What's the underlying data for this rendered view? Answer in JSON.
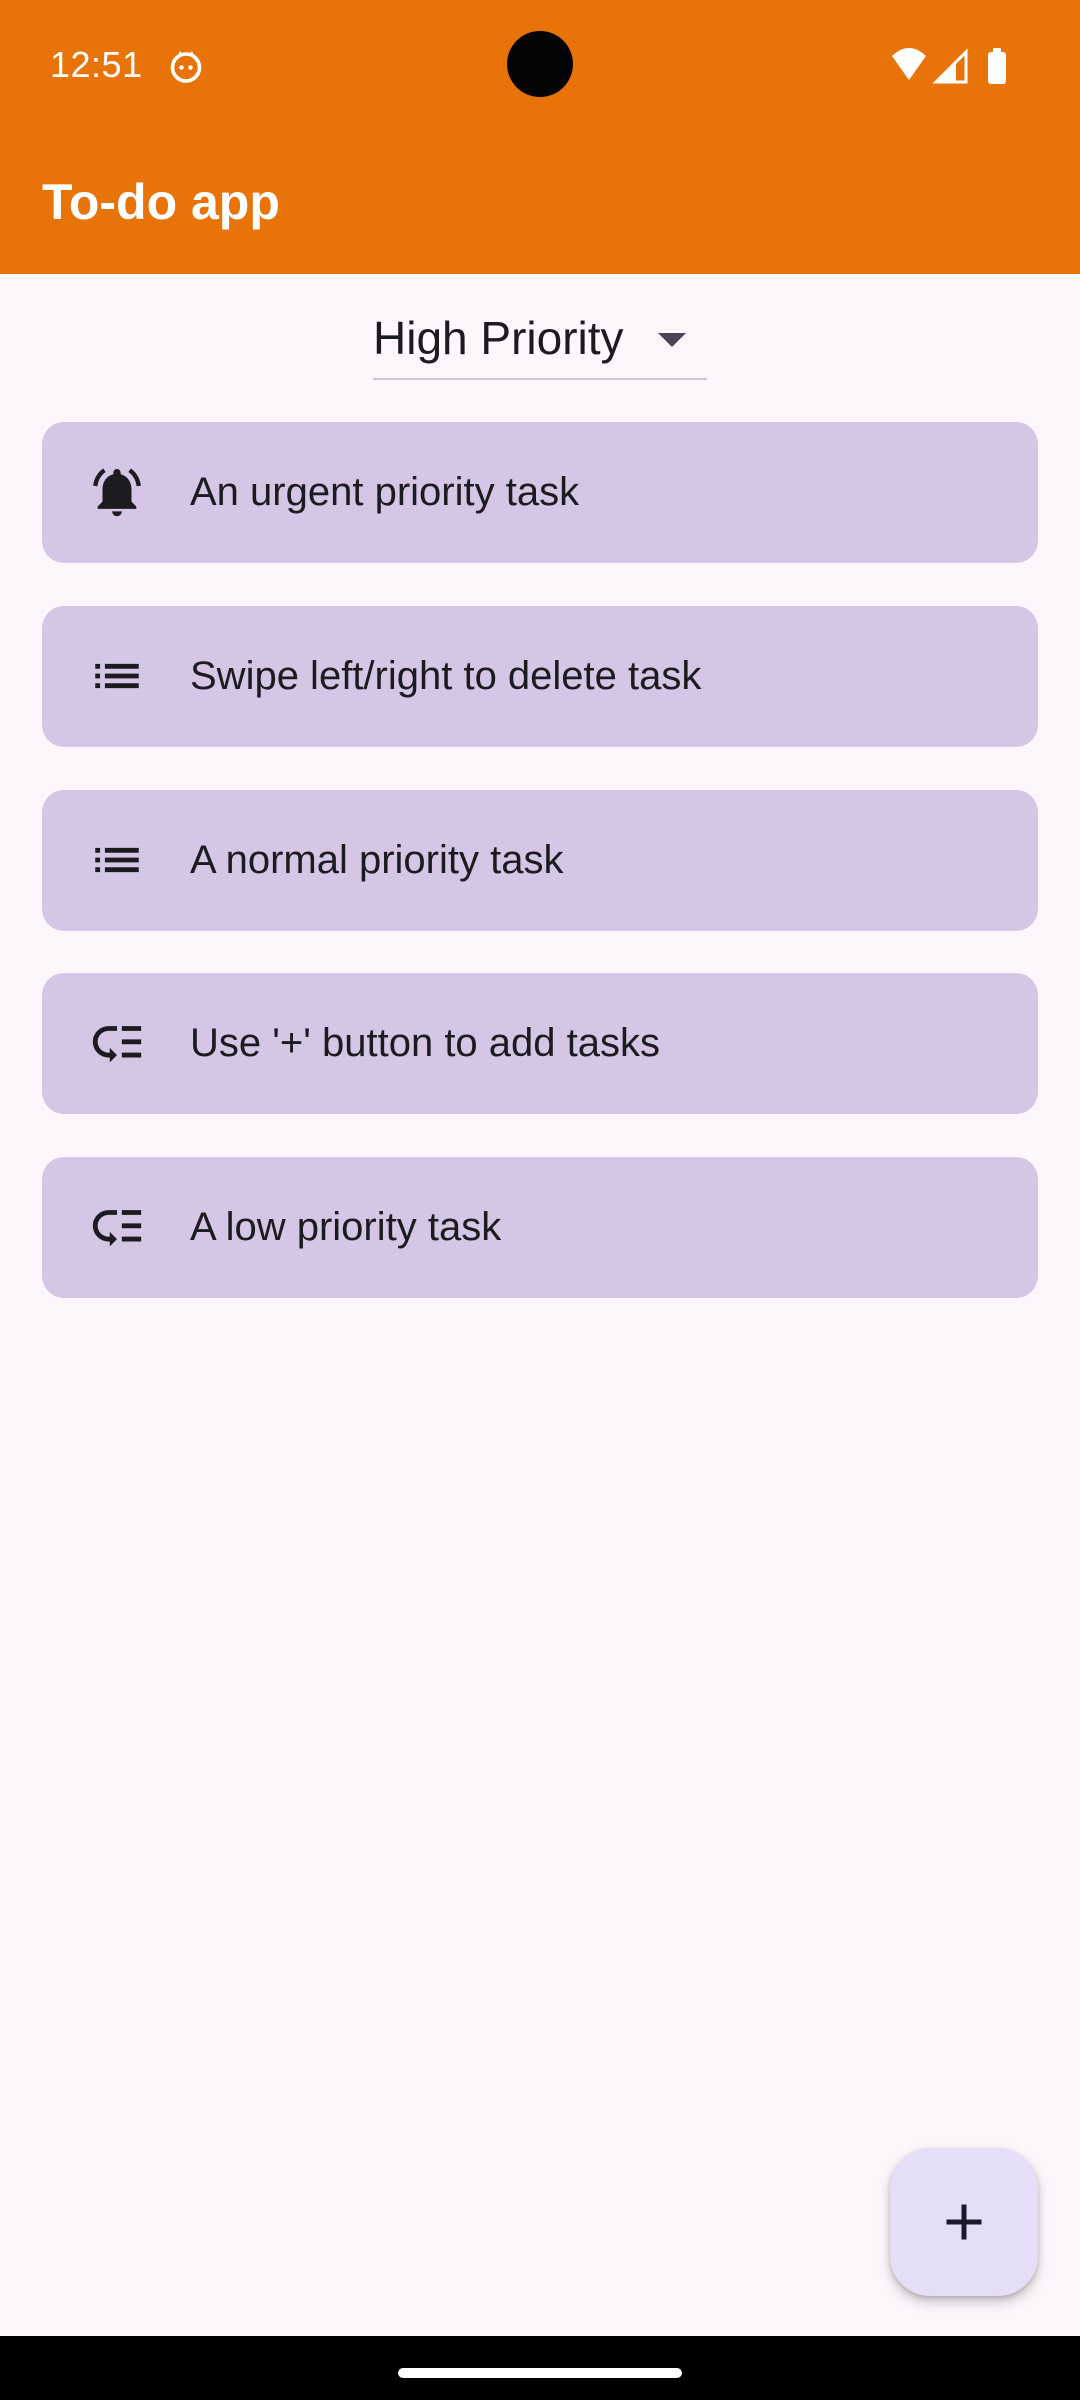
{
  "status_bar": {
    "time": "12:51",
    "icons": [
      "cat-notification-icon",
      "wifi-icon",
      "cell-signal-icon",
      "battery-icon"
    ]
  },
  "app_bar": {
    "title": "To-do app",
    "color": "#E87308"
  },
  "filter": {
    "selected": "High Priority"
  },
  "tasks": [
    {
      "label": "An urgent priority task",
      "icon": "bell-icon"
    },
    {
      "label": "Swipe left/right to delete task",
      "icon": "list-icon"
    },
    {
      "label": "A normal priority task",
      "icon": "list-icon"
    },
    {
      "label": "Use '+' button to add tasks",
      "icon": "low-priority-icon"
    },
    {
      "label": "A low priority task",
      "icon": "low-priority-icon"
    }
  ],
  "fab": {
    "icon": "plus-icon"
  },
  "colors": {
    "background": "#FDF7FC",
    "task_card": "#D6C6E6",
    "fab": "#E5DEF7"
  }
}
